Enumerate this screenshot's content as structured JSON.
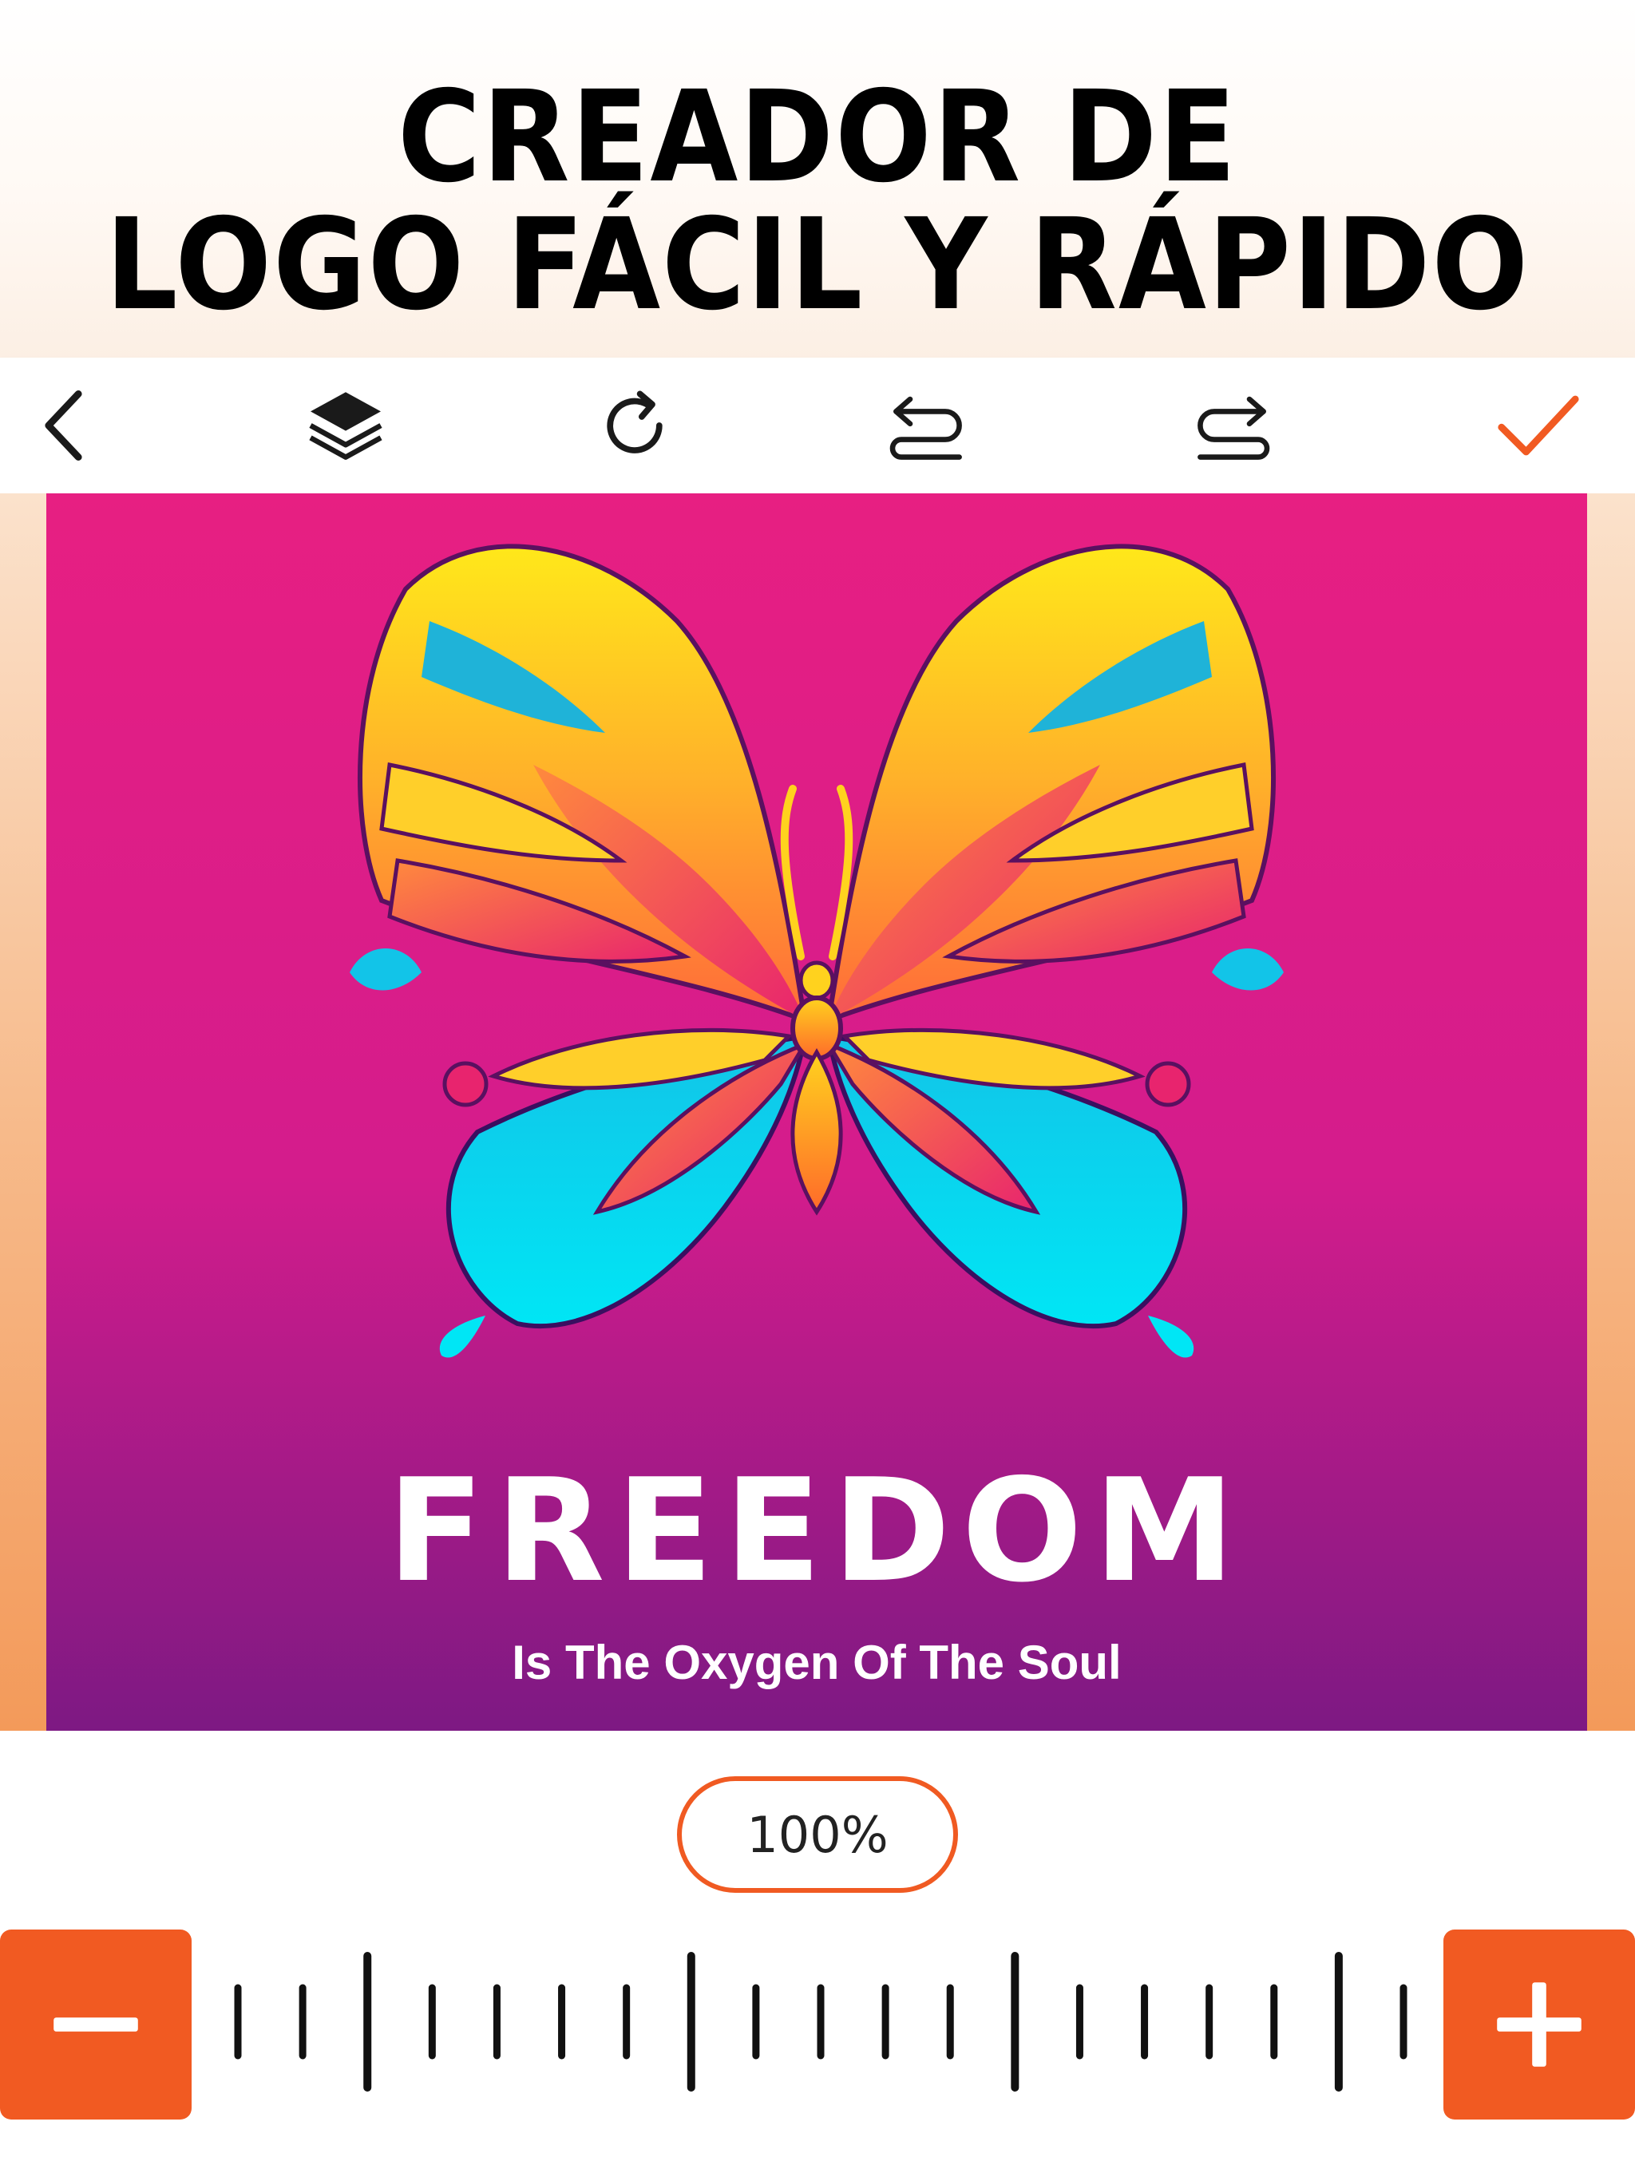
{
  "header": {
    "title_line1": "CREADOR DE",
    "title_line2": "LOGO FÁCIL Y RÁPIDO"
  },
  "toolbar": {
    "back_icon": "chevron-left-icon",
    "layers_icon": "layers-icon",
    "rotate_icon": "rotate-icon",
    "undo_icon": "undo-icon",
    "redo_icon": "redo-icon",
    "confirm_icon": "check-icon"
  },
  "canvas": {
    "logo_title": "FREEDOM",
    "logo_subtitle": "Is The Oxygen Of The Soul"
  },
  "zoom": {
    "level": "100%",
    "minus_icon": "minus-icon",
    "plus_icon": "plus-icon"
  },
  "colors": {
    "accent": "#f15a22",
    "canvas_top": "#e71f82",
    "canvas_bottom": "#7d1983"
  }
}
